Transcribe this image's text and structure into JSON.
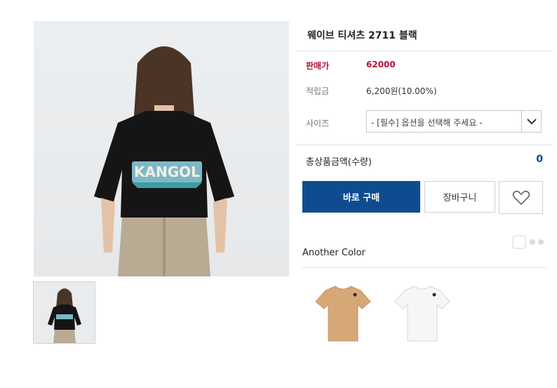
{
  "product": {
    "title": "웨이브 티셔츠 2711 블랙",
    "price_label": "판매가",
    "price_value": "62000",
    "points_label": "적립금",
    "points_value": "6,200원(10.00%)",
    "size_label": "사이즈",
    "size_placeholder": "- [필수] 옵션을 선택해 주세요 -",
    "total_label": "총상품금액(수량)",
    "total_value": "0"
  },
  "actions": {
    "buy_label": "바로 구매",
    "cart_label": "장바구니",
    "wish_icon": "heart-icon"
  },
  "another_color": {
    "heading": "Another Color",
    "items": [
      {
        "color": "#d7a877",
        "icon": "tshirt-icon"
      },
      {
        "color": "#f4f4f4",
        "icon": "tshirt-icon"
      }
    ]
  },
  "colors": {
    "accent": "#0f4c8f",
    "price": "#b4123a",
    "shirt": "#151515"
  }
}
